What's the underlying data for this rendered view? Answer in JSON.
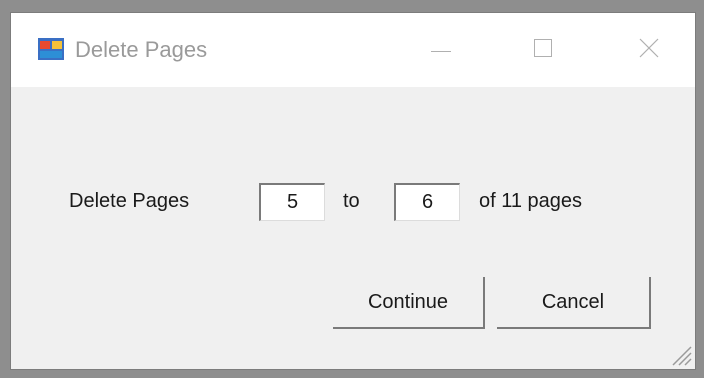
{
  "window": {
    "title": "Delete Pages",
    "icon": "app-window-icon",
    "controls": [
      "minimize-icon",
      "maximize-icon",
      "close-icon"
    ]
  },
  "form": {
    "label": "Delete Pages",
    "from_value": "5",
    "to_label": "to",
    "to_value": "6",
    "total_label": "of 11 pages"
  },
  "buttons": {
    "continue": "Continue",
    "cancel": "Cancel"
  }
}
